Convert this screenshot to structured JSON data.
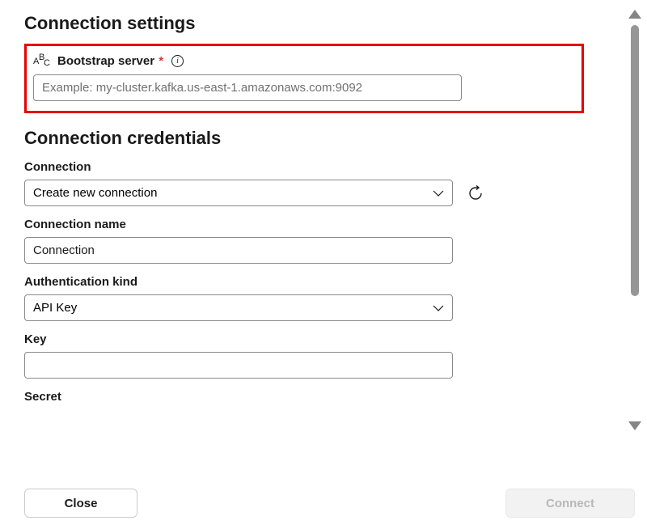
{
  "sections": {
    "settings": {
      "title": "Connection settings",
      "bootstrap": {
        "icon": "abc-icon",
        "label": "Bootstrap server",
        "placeholder": "Example: my-cluster.kafka.us-east-1.amazonaws.com:9092",
        "value": ""
      }
    },
    "credentials": {
      "title": "Connection credentials",
      "connection": {
        "label": "Connection",
        "selected": "Create new connection"
      },
      "connection_name": {
        "label": "Connection name",
        "value": "Connection"
      },
      "auth_kind": {
        "label": "Authentication kind",
        "selected": "API Key"
      },
      "key": {
        "label": "Key",
        "value": ""
      },
      "secret": {
        "label": "Secret"
      }
    }
  },
  "footer": {
    "close": "Close",
    "connect": "Connect"
  }
}
